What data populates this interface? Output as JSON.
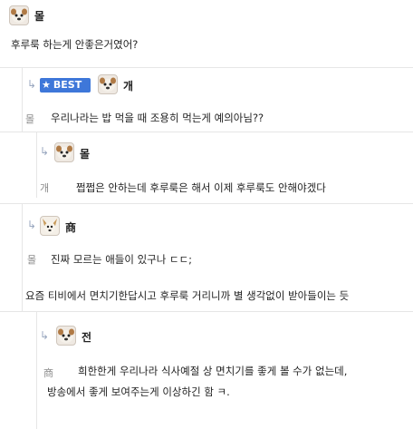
{
  "comments": [
    {
      "nick": "몰",
      "text": "후루룩 하는게 안좋은거였어?"
    },
    {
      "badge": "BEST",
      "nick": "개",
      "reply_to": "몰",
      "text": "우리나라는 밥 먹을 때 조용히 먹는게 예의아님??"
    },
    {
      "nick": "몰",
      "reply_to": "개",
      "text": "쩝쩝은 안하는데 후루룩은 해서 이제 후루룩도 안해야겠다"
    },
    {
      "nick": "商",
      "reply_to": "몰",
      "text": "진짜 모르는 애들이 있구나 ㄷㄷ;",
      "text2": "요즘 티비에서 면치기한답시고 후루룩 거리니까 별 생각없이 받아들이는 듯"
    },
    {
      "nick": "전",
      "reply_to": "商",
      "text": "희한한게 우리나라 식사예절 상 면치기를 좋게 볼 수가 없는데,",
      "text2": "방송에서 좋게 보여주는게 이상하긴 함 ㅋ."
    }
  ],
  "icons": {
    "reply": "reply-arrow-icon",
    "avatar": "dog-avatar-icon",
    "star": "star-icon"
  }
}
